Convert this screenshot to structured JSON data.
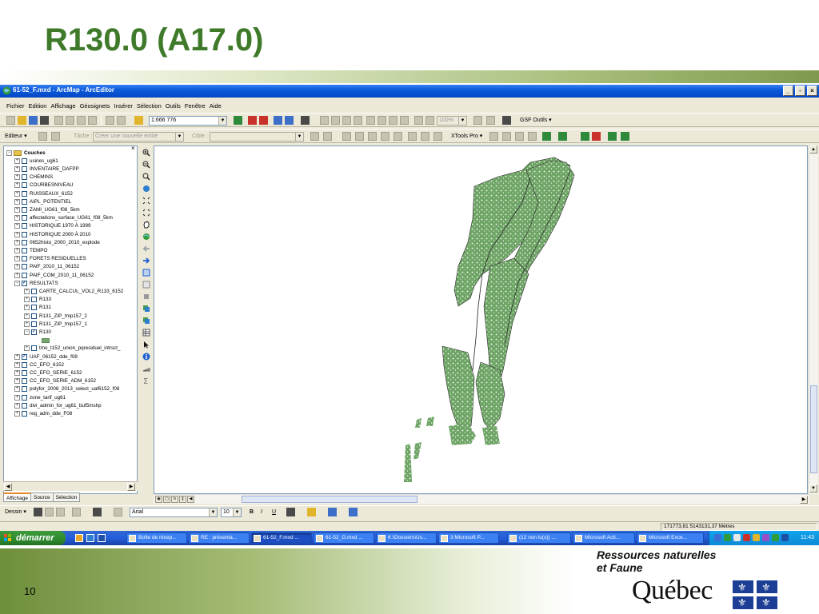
{
  "slide": {
    "title": "R130.0 (A17.0)",
    "page_number": "10",
    "ministry_line1": "Ressources naturelles",
    "ministry_line2": "et Faune",
    "quebec": "Québec"
  },
  "window": {
    "title": "61-52_F.mxd - ArcMap - ArcEditor",
    "minimize": "_",
    "maximize": "▫",
    "close": "×"
  },
  "menu": [
    "Fichier",
    "Edition",
    "Affichage",
    "Géosignets",
    "Insérer",
    "Sélection",
    "Outils",
    "Fenêtre",
    "Aide"
  ],
  "toolbar": {
    "scale": "1:666 776",
    "zoom_percent": "100%",
    "gsf_outils": "GSF Outils ▾",
    "editor": "Editeur ▾",
    "task_label": "Tâche :",
    "task_value": "Créer une nouvelle entité",
    "target_label": "Cible :",
    "xtools": "XTools Pro ▾"
  },
  "toc": {
    "root": "Couches",
    "layers": [
      {
        "name": "usines_ug61",
        "checked": false,
        "level": 1
      },
      {
        "name": "INVENTAIRE_DAFPP",
        "checked": false,
        "level": 1
      },
      {
        "name": "CHEMINS",
        "checked": false,
        "level": 1
      },
      {
        "name": "COURBESNIVEAU",
        "checked": false,
        "level": 1
      },
      {
        "name": "RUISSEAUX_6152",
        "checked": false,
        "level": 1
      },
      {
        "name": "AIPL_POTENTIEL",
        "checked": false,
        "level": 1
      },
      {
        "name": "ZAMI_UG61_f08_5km",
        "checked": false,
        "level": 1
      },
      {
        "name": "affectations_surface_UG61_f08_5km",
        "checked": false,
        "level": 1
      },
      {
        "name": "HISTORIQUE 1970 À 1999",
        "checked": false,
        "level": 1
      },
      {
        "name": "HISTORIQUE 2000 À 2010",
        "checked": false,
        "level": 1
      },
      {
        "name": "0652histo_2000_2010_explode",
        "checked": false,
        "level": 1
      },
      {
        "name": "TEMPO",
        "checked": false,
        "level": 1
      },
      {
        "name": "FORETS RESIDUELLES",
        "checked": false,
        "level": 1
      },
      {
        "name": "PAIF_2010_11_06152",
        "checked": false,
        "level": 1
      },
      {
        "name": "PAIF_COM_2010_11_06152",
        "checked": false,
        "level": 1
      },
      {
        "name": "RESULTATS",
        "checked": true,
        "level": 1,
        "expanded": true
      },
      {
        "name": "CARTE_CALCUL_VOL2_R133_6152",
        "checked": false,
        "level": 2
      },
      {
        "name": "R133",
        "checked": false,
        "level": 2
      },
      {
        "name": "R131",
        "checked": false,
        "level": 2
      },
      {
        "name": "R131_ZIP_tmp157_2",
        "checked": false,
        "level": 2
      },
      {
        "name": "R131_ZIP_tmp157_1",
        "checked": false,
        "level": 2
      },
      {
        "name": "R130",
        "checked": true,
        "level": 2,
        "expanded": true
      },
      {
        "name": "tmo_t152_union_pqresiduel_intrsct_",
        "checked": false,
        "level": 2
      },
      {
        "name": "UAF_06152_dde_f08",
        "checked": true,
        "level": 1
      },
      {
        "name": "CC_EFO_6152",
        "checked": false,
        "level": 1
      },
      {
        "name": "CC_EFO_SERIE_6152",
        "checked": false,
        "level": 1
      },
      {
        "name": "CC_EFO_SERIE_ADM_6152",
        "checked": false,
        "level": 1
      },
      {
        "name": "polyfor_2008_2013_select_uaf6152_f08",
        "checked": false,
        "level": 1
      },
      {
        "name": "zone_tarif_ug61",
        "checked": false,
        "level": 1
      },
      {
        "name": "divi_admin_for_ug61_buf5mshp",
        "checked": false,
        "level": 1
      },
      {
        "name": "reg_adm_dde_F08",
        "checked": false,
        "level": 1
      }
    ],
    "tabs": [
      "Affichage",
      "Source",
      "Sélection"
    ]
  },
  "draw": {
    "dessin": "Dessin ▾",
    "font": "Arial",
    "size": "10",
    "bold": "B",
    "italic": "I",
    "underline": "U"
  },
  "status": {
    "coords": "171773,81  5143131,37 Mètres"
  },
  "taskbar": {
    "start": "démarrer",
    "items": [
      "Boîte de récep...",
      "RE : présenta...",
      "61-52_F.mxd ...",
      "61-52_G.mxd ...",
      "K:\\Dossiers\\Us...",
      "3 Microsoft P...",
      "(12 non lu(s)) ...",
      "Microsoft Acti...",
      "Microsoft Exce..."
    ],
    "clock": "11:43"
  },
  "colors": {
    "title_green": "#3f7a2a",
    "map_fill": "#6fa566",
    "xp_blue": "#0a5adb"
  }
}
